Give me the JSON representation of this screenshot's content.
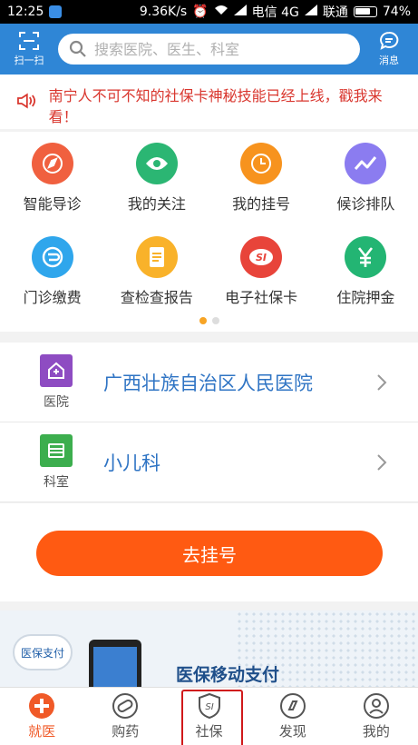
{
  "status_bar": {
    "time": "12:25",
    "speed": "9.36K/s",
    "carrier1": "电信 4G",
    "carrier2": "联通",
    "battery": "74%",
    "battery_level": 0.74
  },
  "header": {
    "scan_label": "扫一扫",
    "search_placeholder": "搜索医院、医生、科室",
    "messages_label": "消息"
  },
  "notice": {
    "text": "南宁人不可不知的社保卡神秘技能已经上线，戳我来看！"
  },
  "services": [
    {
      "label": "智能导诊",
      "icon": "compass-icon",
      "color": "#f0603f"
    },
    {
      "label": "我的关注",
      "icon": "eye-icon",
      "color": "#2bb673"
    },
    {
      "label": "我的挂号",
      "icon": "clock-icon",
      "color": "#f7931e"
    },
    {
      "label": "候诊排队",
      "icon": "trend-icon",
      "color": "#8b7cf0"
    },
    {
      "label": "门诊缴费",
      "icon": "payment-icon",
      "color": "#2fa6ec"
    },
    {
      "label": "查检查报告",
      "icon": "report-icon",
      "color": "#f9b22a"
    },
    {
      "label": "电子社保卡",
      "icon": "si-card-icon",
      "color": "#e8443a"
    },
    {
      "label": "住院押金",
      "icon": "yuan-icon",
      "color": "#23b573"
    }
  ],
  "pager": {
    "count": 2,
    "active": 0
  },
  "selection": {
    "hospital": {
      "caption": "医院",
      "value": "广西壮族自治区人民医院",
      "color": "#8e4cc2"
    },
    "department": {
      "caption": "科室",
      "value": "小儿科",
      "color": "#3cae4e"
    }
  },
  "register_button": "去挂号",
  "banner": {
    "badge": "医保支付",
    "title": "医保移动支付"
  },
  "tabs": [
    {
      "label": "就医",
      "icon": "medical-cross-icon",
      "active": true
    },
    {
      "label": "购药",
      "icon": "pill-icon",
      "active": false
    },
    {
      "label": "社保",
      "icon": "social-security-icon",
      "active": false,
      "highlighted": true
    },
    {
      "label": "发现",
      "icon": "discover-icon",
      "active": false
    },
    {
      "label": "我的",
      "icon": "profile-icon",
      "active": false
    }
  ]
}
